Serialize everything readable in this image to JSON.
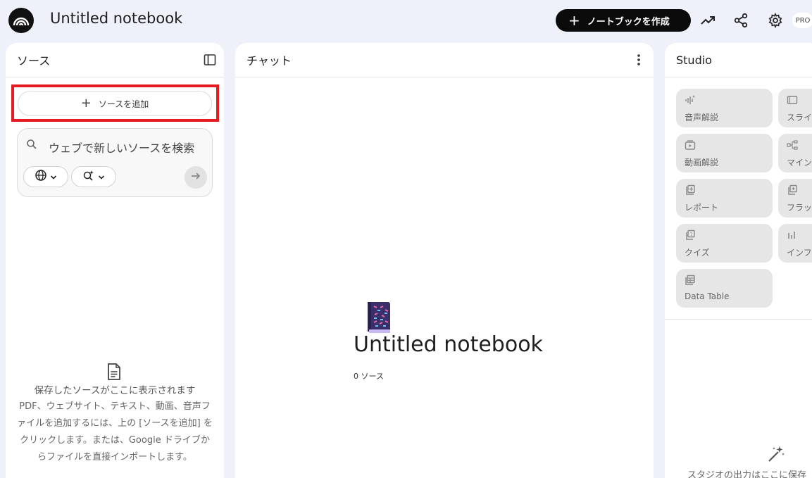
{
  "header": {
    "title": "Untitled notebook",
    "create_label": "ノートブックを作成",
    "pro_badge": "PRO"
  },
  "sources": {
    "title": "ソース",
    "add_label": "ソースを追加",
    "search_placeholder": "ウェブで新しいソースを検索",
    "empty_title": "保存したソースがここに表示されます",
    "empty_desc": "PDF、ウェブサイト、テキスト、動画、音声ファイルを追加するには、上の [ソースを追加] をクリックします。または、Google ドライブからファイルを直接インポートします。"
  },
  "chat": {
    "title": "チャット",
    "notebook_title": "Untitled notebook",
    "source_count": "0 ソース"
  },
  "studio": {
    "title": "Studio",
    "tiles": [
      {
        "label": "音声解説",
        "icon": "audio-icon"
      },
      {
        "label": "スライ",
        "icon": "slides-icon"
      },
      {
        "label": "動画解説",
        "icon": "video-icon"
      },
      {
        "label": "マイン",
        "icon": "mindmap-icon"
      },
      {
        "label": "レポート",
        "icon": "report-icon"
      },
      {
        "label": "フラッ",
        "icon": "flashcard-icon"
      },
      {
        "label": "クイズ",
        "icon": "quiz-icon"
      },
      {
        "label": "インフ",
        "icon": "infographic-icon"
      },
      {
        "label": "Data Table",
        "icon": "table-icon"
      }
    ],
    "empty_text": "スタジオの出力はここに保存"
  }
}
